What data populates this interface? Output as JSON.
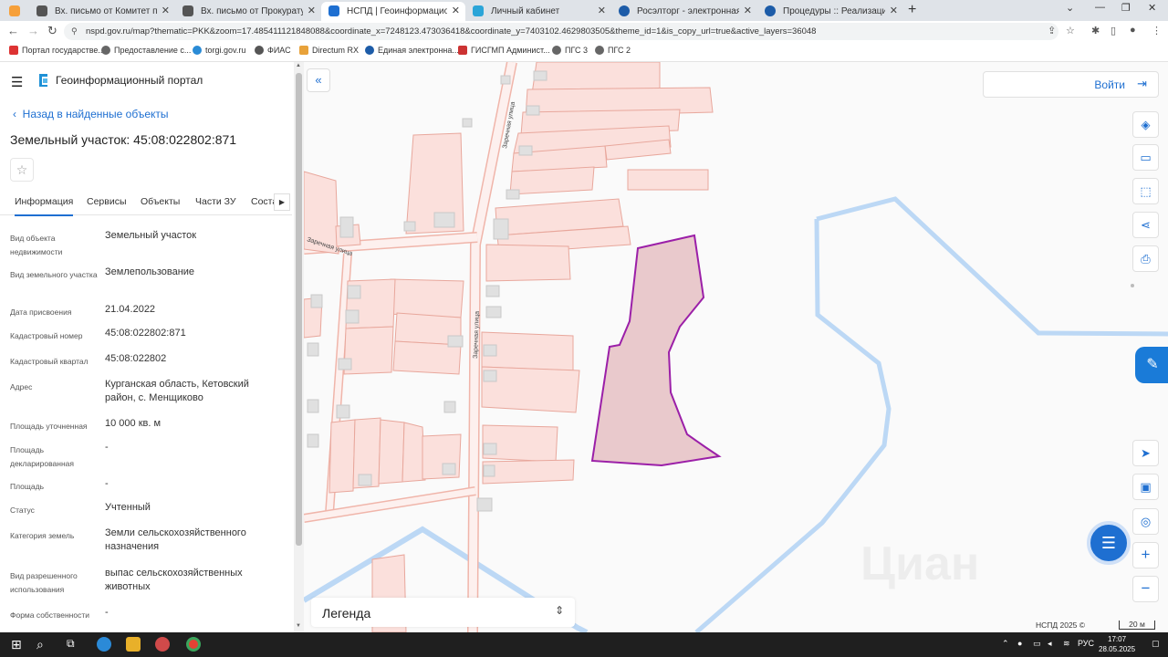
{
  "browser": {
    "tabs": [
      {
        "label": "Вх. письмо от Комитет по упра",
        "color": "#f6a03a"
      },
      {
        "label": "Вх. письмо от Прокуратура Кет",
        "color": "#555555"
      },
      {
        "label": "НСПД | Геоинформационный п",
        "color": "#1e6fd1",
        "active": true
      },
      {
        "label": "Личный кабинет",
        "color": "#2ba5d8"
      },
      {
        "label": "Росэлторг - электронная торгов",
        "color": "#1d5ca8"
      },
      {
        "label": "Процедуры :: Реализация госи",
        "color": "#1d5ca8"
      }
    ],
    "url": "nspd.gov.ru/map?thematic=PKK&zoom=17.485411121848088&coordinate_x=7248123.473036418&coordinate_y=7403102.4629803505&theme_id=1&is_copy_url=true&active_layers=36048",
    "bookmarks": [
      {
        "label": "Портал государстве...",
        "color": "#d33"
      },
      {
        "label": "Предоставление с...",
        "color": "#666"
      },
      {
        "label": "torgi.gov.ru",
        "color": "#2a8bd6"
      },
      {
        "label": "ФИАС",
        "color": "#555"
      },
      {
        "label": "Directum RX",
        "color": "#e8a23a"
      },
      {
        "label": "Единая электронна...",
        "color": "#1d5ca8"
      },
      {
        "label": "ГИСГМП Админист...",
        "color": "#c33"
      },
      {
        "label": "ПГС 3",
        "color": "#666"
      },
      {
        "label": "ПГС 2",
        "color": "#666"
      }
    ]
  },
  "panel": {
    "portal_name": "Геоинформационный портал",
    "back_label": "Назад в найденные объекты",
    "title": "Земельный участок: 45:08:022802:871",
    "tabs": [
      "Информация",
      "Сервисы",
      "Объекты",
      "Части ЗУ",
      "Соста"
    ],
    "rows": [
      {
        "label": "Вид объекта недвижимости",
        "value": "Земельный участок"
      },
      {
        "label": "Вид земельного участка",
        "value": "Землепользование"
      },
      {
        "label": "Дата присвоения",
        "value": "21.04.2022"
      },
      {
        "label": "Кадастровый номер",
        "value": "45:08:022802:871"
      },
      {
        "label": "Кадастровый квартал",
        "value": "45:08:022802"
      },
      {
        "label": "Адрес",
        "value": "Курганская область, Кетовский район, с. Менщиково"
      },
      {
        "label": "Площадь уточненная",
        "value": "10 000 кв. м"
      },
      {
        "label": "Площадь декларированная",
        "value": "-"
      },
      {
        "label": "Площадь",
        "value": "-"
      },
      {
        "label": "Статус",
        "value": "Учтенный"
      },
      {
        "label": "Категория земель",
        "value": "Земли сельскохозяйственного назначения"
      },
      {
        "label": "Вид разрешенного использования",
        "value": "выпас сельскохозяйственных животных"
      },
      {
        "label": "Форма собственности",
        "value": "-"
      }
    ]
  },
  "map": {
    "login_label": "Войти",
    "legend_label": "Легенда",
    "street_1": "Заречная улица",
    "street_2": "Заречная улица",
    "street_3": "Заречная улица",
    "copyright": "НСПД 2025 ©",
    "scale": "20 м",
    "watermark": "Циан",
    "colors": {
      "parcel_fill": "#fbe0dc",
      "parcel_stroke": "#e8a79c",
      "selected_fill": "#e9c9cc",
      "selected_stroke": "#9b1fa8",
      "road": "#bcd8f5",
      "accent": "#1e6fd1"
    }
  },
  "taskbar": {
    "lang": "РУС",
    "time": "17:07",
    "date": "28.05.2025"
  }
}
